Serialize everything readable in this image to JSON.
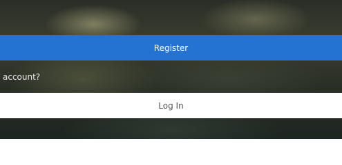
{
  "register": {
    "label": "Register"
  },
  "prompt": {
    "text": "account?"
  },
  "login": {
    "label": "Log In"
  },
  "colors": {
    "register_bg": "#2473d3",
    "login_bg": "#ffffff"
  }
}
